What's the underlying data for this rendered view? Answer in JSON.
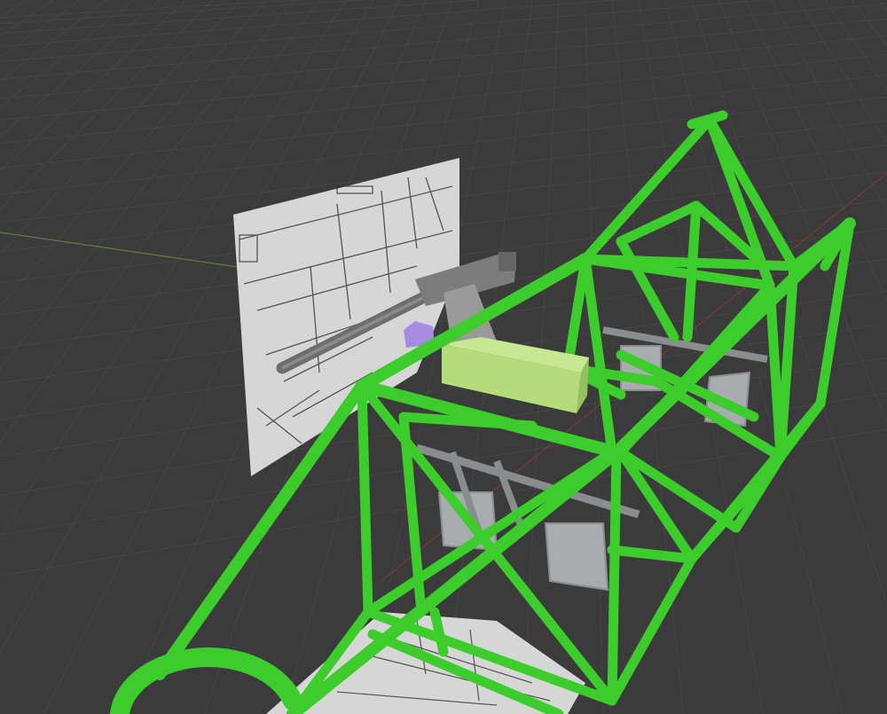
{
  "viewport": {
    "background_color": "#3b3b3b",
    "grid_color": "#454545",
    "x_axis_color": "#7a3a3a",
    "y_axis_color": "#5a7a3a"
  },
  "scene": {
    "frame_color": "#3ccc2c",
    "frame_shade_color": "#2ea820",
    "cargo_box_color": "#b5dc7a",
    "gun_color": "#7a7a7a",
    "mount_color": "#a58ce0",
    "seat_color": "#a9acaf",
    "reference_image_color": "#d8d8d8"
  }
}
